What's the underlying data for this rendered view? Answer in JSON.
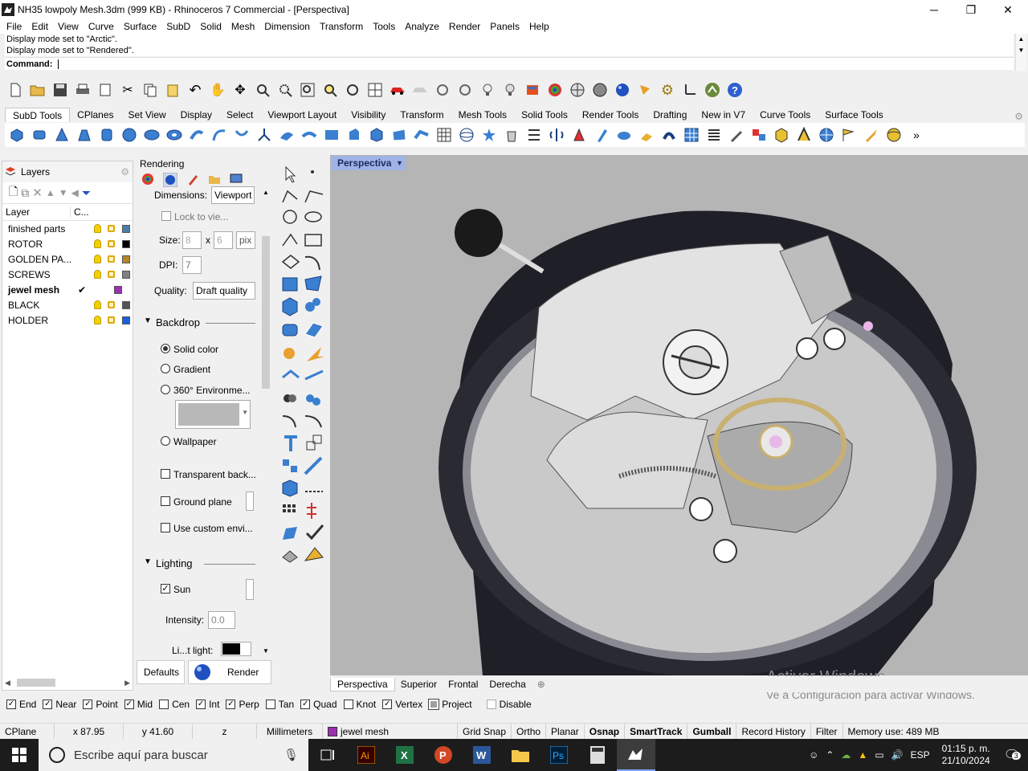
{
  "window": {
    "title": "NH35 lowpoly Mesh.3dm (999 KB) - Rhinoceros 7 Commercial - [Perspectiva]",
    "minimize": "─",
    "maximize": "❐",
    "close": "✕"
  },
  "menu": [
    "File",
    "Edit",
    "View",
    "Curve",
    "Surface",
    "SubD",
    "Solid",
    "Mesh",
    "Dimension",
    "Transform",
    "Tools",
    "Analyze",
    "Render",
    "Panels",
    "Help"
  ],
  "command": {
    "history": [
      "Display mode set to \"Arctic\".",
      "Display mode set to \"Rendered\"."
    ],
    "prompt": "Command:"
  },
  "toolbar_tabs": [
    "SubD Tools",
    "CPlanes",
    "Set View",
    "Display",
    "Select",
    "Viewport Layout",
    "Visibility",
    "Transform",
    "Mesh Tools",
    "Solid Tools",
    "Render Tools",
    "Drafting",
    "New in V7",
    "Curve Tools",
    "Surface Tools"
  ],
  "layers_panel": {
    "title": "Layers",
    "col_layer": "Layer",
    "col_color": "C...",
    "rows": [
      {
        "name": "finished parts",
        "color": "#4a7fa8",
        "current": false
      },
      {
        "name": "ROTOR",
        "color": "#000000",
        "current": false
      },
      {
        "name": "GOLDEN PA...",
        "color": "#b8862e",
        "current": false
      },
      {
        "name": "SCREWS",
        "color": "#808080",
        "current": false
      },
      {
        "name": "jewel mesh",
        "color": "#9b2fae",
        "current": true
      },
      {
        "name": "BLACK",
        "color": "#555555",
        "current": false
      },
      {
        "name": "HOLDER",
        "color": "#1a5fe0",
        "current": false
      }
    ]
  },
  "rendering_panel": {
    "title": "Rendering",
    "dimensions_label": "Dimensions:",
    "dimensions_value": "Viewport",
    "lock_label": "Lock to vie...",
    "size_label": "Size:",
    "size_w": "8",
    "size_x": "x",
    "size_h": "6",
    "size_unit": "pix",
    "dpi_label": "DPI:",
    "dpi_value": "7",
    "quality_label": "Quality:",
    "quality_value": "Draft quality",
    "backdrop_header": "Backdrop",
    "backdrop_options": [
      "Solid color",
      "Gradient",
      "360° Environme...",
      "Wallpaper"
    ],
    "backdrop_selected": "Solid color",
    "transparent_label": "Transparent back...",
    "ground_label": "Ground plane",
    "custom_env_label": "Use custom envi...",
    "lighting_header": "Lighting",
    "sun_label": "Sun",
    "intensity_label": "Intensity:",
    "intensity_value": "0.0",
    "light_label": "Li...t light:",
    "defaults_button": "Defaults",
    "render_button": "Render"
  },
  "viewport": {
    "name": "Perspectiva",
    "tabs": [
      "Perspectiva",
      "Superior",
      "Frontal",
      "Derecha"
    ],
    "active_tab": "Perspectiva"
  },
  "watermark": {
    "line1": "Activar Windows",
    "line2": "Ve a Configuración para activar Windows."
  },
  "osnap": [
    {
      "label": "End",
      "checked": true
    },
    {
      "label": "Near",
      "checked": true
    },
    {
      "label": "Point",
      "checked": true
    },
    {
      "label": "Mid",
      "checked": true
    },
    {
      "label": "Cen",
      "checked": false
    },
    {
      "label": "Int",
      "checked": true
    },
    {
      "label": "Perp",
      "checked": true
    },
    {
      "label": "Tan",
      "checked": false
    },
    {
      "label": "Quad",
      "checked": true
    },
    {
      "label": "Knot",
      "checked": false
    },
    {
      "label": "Vertex",
      "checked": true
    },
    {
      "label": "Project",
      "checked": false
    },
    {
      "label": "Disable",
      "checked": false
    }
  ],
  "status": {
    "cplane": "CPlane",
    "x": "x 87.95",
    "y": "y 41.60",
    "z": "z",
    "units": "Millimeters",
    "layer": "jewel mesh",
    "layer_color": "#9b2fae",
    "grid_snap": "Grid Snap",
    "ortho": "Ortho",
    "planar": "Planar",
    "osnap": "Osnap",
    "smarttrack": "SmartTrack",
    "gumball": "Gumball",
    "record_history": "Record History",
    "filter": "Filter",
    "memory": "Memory use: 489 MB"
  },
  "taskbar": {
    "search_placeholder": "Escribe aquí para buscar",
    "lang": "ESP",
    "time": "01:15 p. m.",
    "date": "21/10/2024",
    "notif_count": "3"
  }
}
